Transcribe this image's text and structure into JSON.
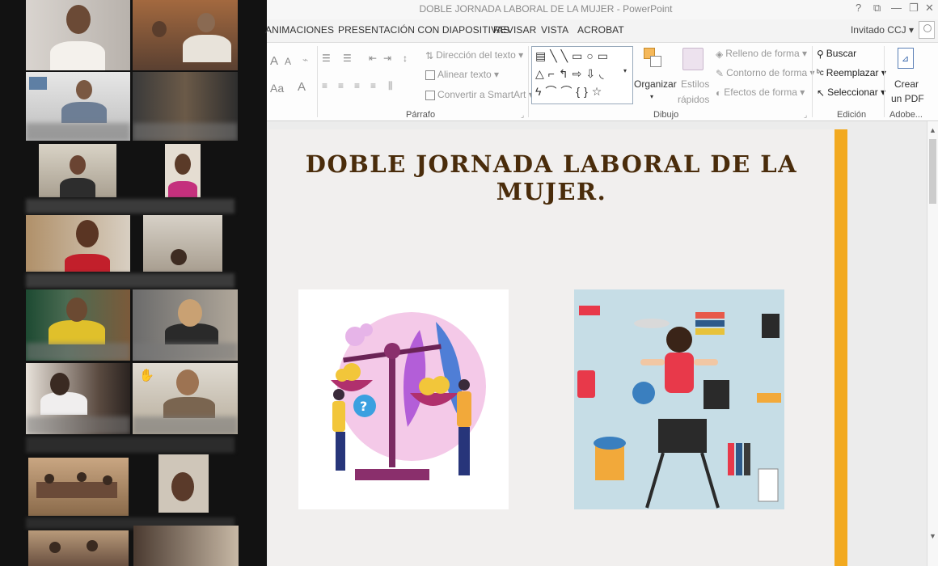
{
  "window": {
    "title": "DOBLE JORNADA LABORAL DE LA MUJER - PowerPoint",
    "help": "?",
    "controls": [
      "⧉",
      "—",
      "❐",
      "✕"
    ]
  },
  "ribbon_tabs": [
    "ANIMACIONES",
    "PRESENTACIÓN CON DIAPOSITIVAS",
    "REVISAR",
    "VISTA",
    "ACROBAT"
  ],
  "user": {
    "name": "Invitado CCJ ▾"
  },
  "ribbon": {
    "font": {
      "grow": "A",
      "shrink": "A",
      "case": "Aa",
      "color": "A"
    },
    "paragraph": {
      "label": "Párrafo",
      "text_direction": "Dirección del texto",
      "align_text": "Alinear texto",
      "smartart": "Convertir a SmartArt"
    },
    "drawing": {
      "label": "Dibujo",
      "shapes_row1": "▤╲╲▭○▭",
      "shapes_row2": "△⌐↰⇨⇩◟",
      "shapes_row3": "ϟ⌒⌒{}☆",
      "arrange": "Organizar",
      "styles": "Estilos",
      "styles2": "rápidos",
      "fill": "Relleno de forma",
      "outline": "Contorno de forma",
      "effects": "Efectos de forma"
    },
    "editing": {
      "label": "Edición",
      "find": "Buscar",
      "replace": "Reemplazar",
      "select": "Seleccionar"
    },
    "adobe": {
      "label": "Adobe...",
      "create_pdf_1": "Crear",
      "create_pdf_2": "un PDF"
    }
  },
  "slide": {
    "title": "DOBLE JORNADA LABORAL DE LA MUJER.",
    "accent_color": "#f2a91f",
    "title_color": "#4a2c0b"
  },
  "gallery": {
    "active_border": "#3fb34f",
    "hand_icon": "✋"
  }
}
